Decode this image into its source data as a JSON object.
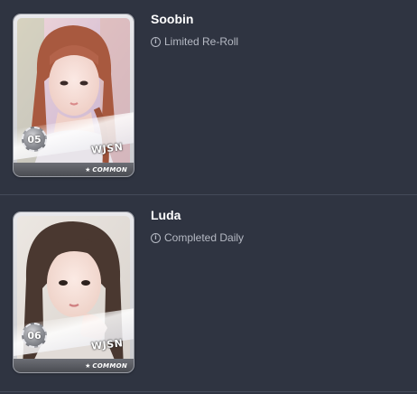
{
  "entries": [
    {
      "name": "Soobin",
      "status": "Limited Re-Roll",
      "card_number": "05",
      "group": "WJSN",
      "rarity": "COMMON",
      "status_icon": "info-circle-icon"
    },
    {
      "name": "Luda",
      "status": "Completed Daily",
      "card_number": "06",
      "group": "WJSN",
      "rarity": "COMMON",
      "status_icon": "info-circle-icon"
    }
  ],
  "colors": {
    "background": "#2f3441",
    "name": "#ffffff",
    "status": "#b5b9c3",
    "divider": "#454b59"
  }
}
